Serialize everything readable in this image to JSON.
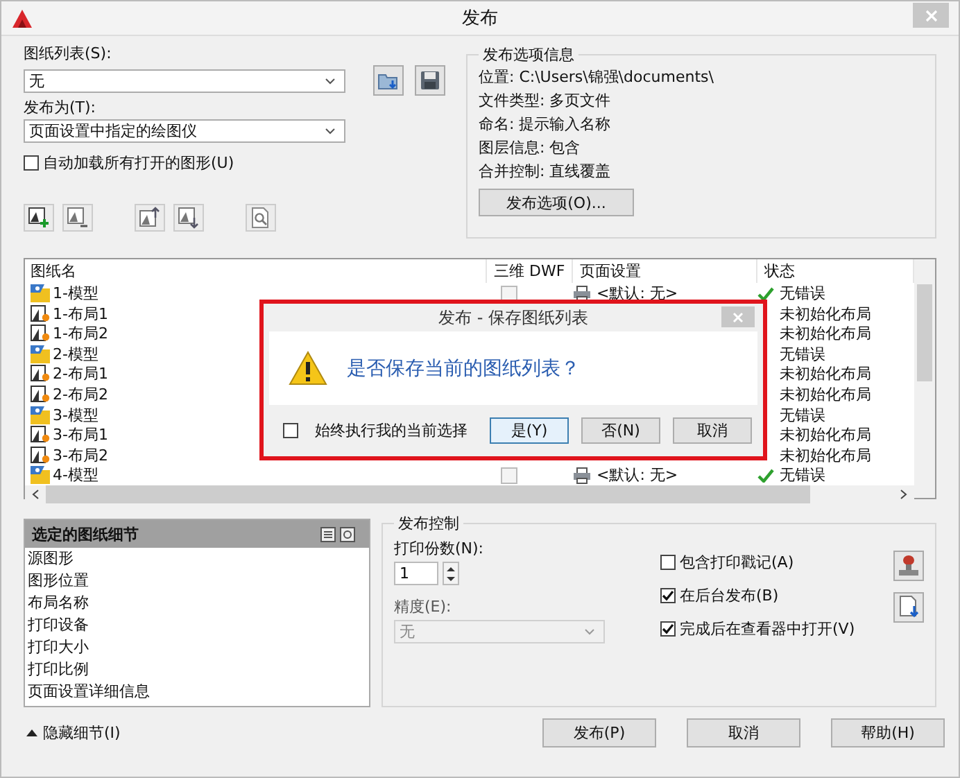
{
  "window": {
    "title": "发布"
  },
  "sheet_list": {
    "label": "图纸列表(S):",
    "value": "无"
  },
  "publish_to": {
    "label": "发布为(T):",
    "value": "页面设置中指定的绘图仪"
  },
  "auto_load": {
    "label": "自动加载所有打开的图形(U)",
    "checked": false
  },
  "publish_options_info": {
    "title": "发布选项信息",
    "lines": [
      "位置: C:\\Users\\锦强\\documents\\",
      "文件类型: 多页文件",
      "命名: 提示输入名称",
      "图层信息: 包含",
      "合并控制: 直线覆盖"
    ],
    "button": "发布选项(O)..."
  },
  "sheet_table": {
    "columns": [
      "图纸名",
      "三维 DWF",
      "页面设置",
      "状态"
    ],
    "rows": [
      {
        "name": "1-模型",
        "kind": "model",
        "dwf_checked": false,
        "page_setup": "<默认: 无>",
        "status": "无错误",
        "status_ok": true
      },
      {
        "name": "1-布局1",
        "kind": "layout",
        "status": "未初始化布局"
      },
      {
        "name": "1-布局2",
        "kind": "layout",
        "status": "未初始化布局"
      },
      {
        "name": "2-模型",
        "kind": "model",
        "status": "无错误"
      },
      {
        "name": "2-布局1",
        "kind": "layout",
        "status": "未初始化布局"
      },
      {
        "name": "2-布局2",
        "kind": "layout",
        "status": "未初始化布局"
      },
      {
        "name": "3-模型",
        "kind": "model",
        "status": "无错误"
      },
      {
        "name": "3-布局1",
        "kind": "layout",
        "status": "未初始化布局"
      },
      {
        "name": "3-布局2",
        "kind": "layout",
        "status": "未初始化布局"
      },
      {
        "name": "4-模型",
        "kind": "model",
        "dwf_checked": false,
        "page_setup": "<默认: 无>",
        "status": "无错误",
        "status_ok": true
      }
    ]
  },
  "dialog": {
    "title": "发布 - 保存图纸列表",
    "message": "是否保存当前的图纸列表？",
    "remember": {
      "label": "始终执行我的当前选择",
      "checked": false
    },
    "buttons": [
      {
        "label": "是(Y)",
        "selected": true
      },
      {
        "label": "否(N)",
        "selected": false
      },
      {
        "label": "取消",
        "selected": false
      }
    ]
  },
  "details": {
    "title": "选定的图纸细节",
    "items": [
      "源图形",
      "图形位置",
      "布局名称",
      "打印设备",
      "打印大小",
      "打印比例",
      "页面设置详细信息"
    ],
    "toggle": "隐藏细节(I)"
  },
  "publish_control": {
    "title": "发布控制",
    "copies_label": "打印份数(N):",
    "copies": "1",
    "precision_label": "精度(E):",
    "precision": "无",
    "precision_disabled": true,
    "options": [
      {
        "label": "包含打印戳记(A)",
        "checked": false
      },
      {
        "label": "在后台发布(B)",
        "checked": true
      },
      {
        "label": "完成后在查看器中打开(V)",
        "checked": true
      }
    ]
  },
  "buttons": [
    "发布(P)",
    "取消",
    "帮助(H)"
  ]
}
